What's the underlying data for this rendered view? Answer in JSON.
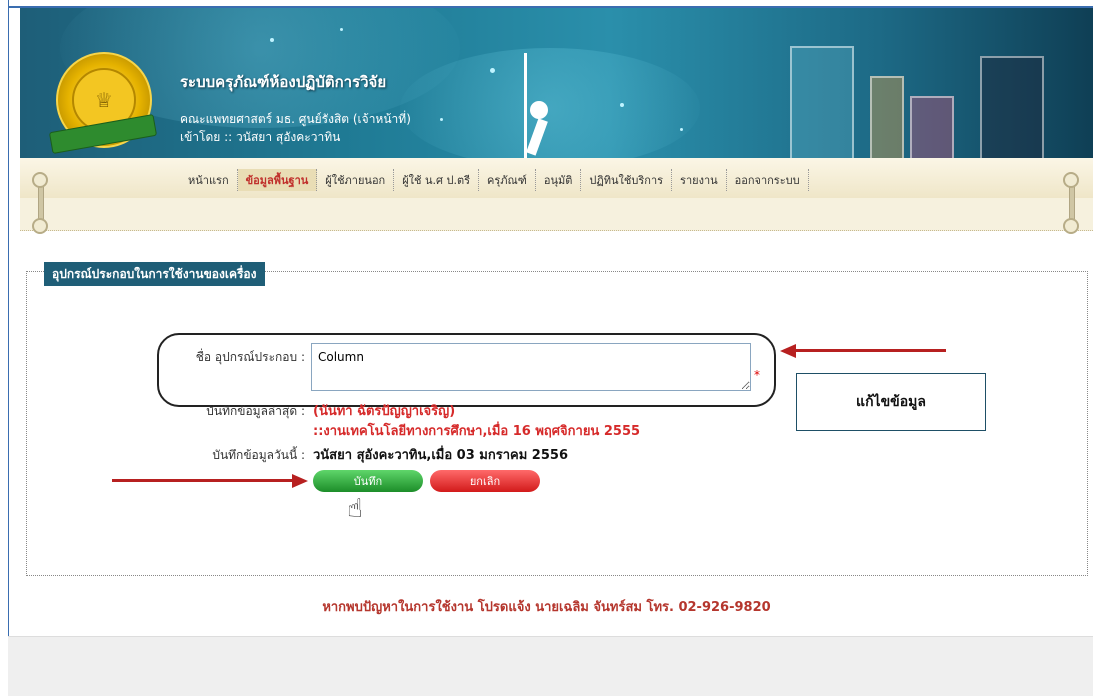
{
  "header": {
    "system_title": "ระบบครุภัณฑ์ห้องปฏิบัติการวิจัย",
    "faculty": "คณะแพทยศาสตร์ มธ. ศูนย์รังสิต (เจ้าหน้าที่)",
    "login_by": "เข้าโดย :: วนัสยา สุอังคะวาทิน"
  },
  "nav": {
    "items": [
      {
        "label": "หน้าแรก"
      },
      {
        "label": "ข้อมูลพื้นฐาน",
        "active": true
      },
      {
        "label": "ผู้ใช้ภายนอก"
      },
      {
        "label": "ผู้ใช้ น.ศ ป.ตรี"
      },
      {
        "label": "ครุภัณฑ์"
      },
      {
        "label": "อนุมัติ"
      },
      {
        "label": "ปฏิทินใช้บริการ"
      },
      {
        "label": "รายงาน"
      },
      {
        "label": "ออกจากระบบ"
      }
    ]
  },
  "section": {
    "title": "อุปกรณ์ประกอบในการใช้งานของเครื่อง"
  },
  "form": {
    "name_label": "ชื่อ อุปกรณ์ประกอบ :",
    "name_value": "Column",
    "required_mark": "*",
    "last_saved_label": "บันทึกข้อมูลล่าสุด :",
    "last_saved_name": "(นันทา ฉัตรปัญญาเจริญ)",
    "last_saved_org": "::งานเทคโนโลยีทางการศึกษา,เมื่อ 16 พฤศจิกายน 2555",
    "today_label": "บันทึกข้อมูลวันนี้ :",
    "today_value": "วนัสยา สุอังคะวาทิน,เมื่อ 03 มกราคม 2556",
    "save_button": "บันทึก",
    "cancel_button": "ยกเลิก"
  },
  "annotation": {
    "edit_label": "แก้ไขข้อมูล"
  },
  "footer": {
    "text": "หากพบปัญหาในการใช้งาน โปรดแจ้ง นายเฉลิม จันทร์สม โทร. 02-926-9820"
  },
  "colors": {
    "banner": "#1f7a94",
    "panel_header": "#1f5e77",
    "active_nav": "#c0302c",
    "save_button": "#1c8d29",
    "cancel_button": "#d21a1a",
    "annotation_arrow": "#b72020",
    "footer_text": "#b5362d"
  },
  "icons": {
    "logo": "university-seal-icon",
    "cursor": "hand-pointer-icon",
    "logout": "logout-icon"
  }
}
